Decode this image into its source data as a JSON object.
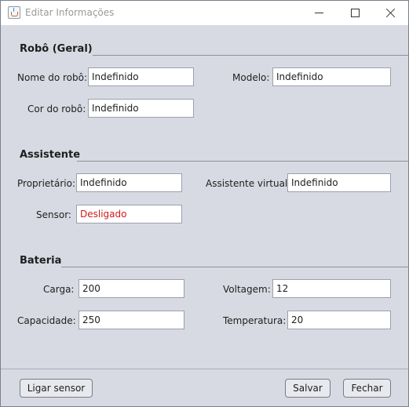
{
  "window": {
    "title": "Editar Informações"
  },
  "sections": {
    "robot": {
      "title": "Robô (Geral)",
      "name_label": "Nome do robô:",
      "name_value": "Indefinido",
      "model_label": "Modelo:",
      "model_value": "Indefinido",
      "color_label": "Cor do robô:",
      "color_value": "Indefinido"
    },
    "assistant": {
      "title": "Assistente",
      "owner_label": "Proprietário:",
      "owner_value": "Indefinido",
      "virtual_label": "Assistente virtual:",
      "virtual_value": "Indefinido",
      "sensor_label": "Sensor:",
      "sensor_value": "Desligado"
    },
    "battery": {
      "title": "Bateria",
      "charge_label": "Carga:",
      "charge_value": "200",
      "voltage_label": "Voltagem:",
      "voltage_value": "12",
      "capacity_label": "Capacidade:",
      "capacity_value": "250",
      "temperature_label": "Temperatura:",
      "temperature_value": "20"
    }
  },
  "buttons": {
    "sensor": "Ligar sensor",
    "save": "Salvar",
    "close": "Fechar"
  },
  "colors": {
    "background": "#d8dae3",
    "sensor_off_text": "#d21a1a"
  },
  "icons": {
    "app": "java-cup-icon",
    "minimize": "minimize-icon",
    "maximize": "maximize-icon",
    "close": "close-icon"
  }
}
